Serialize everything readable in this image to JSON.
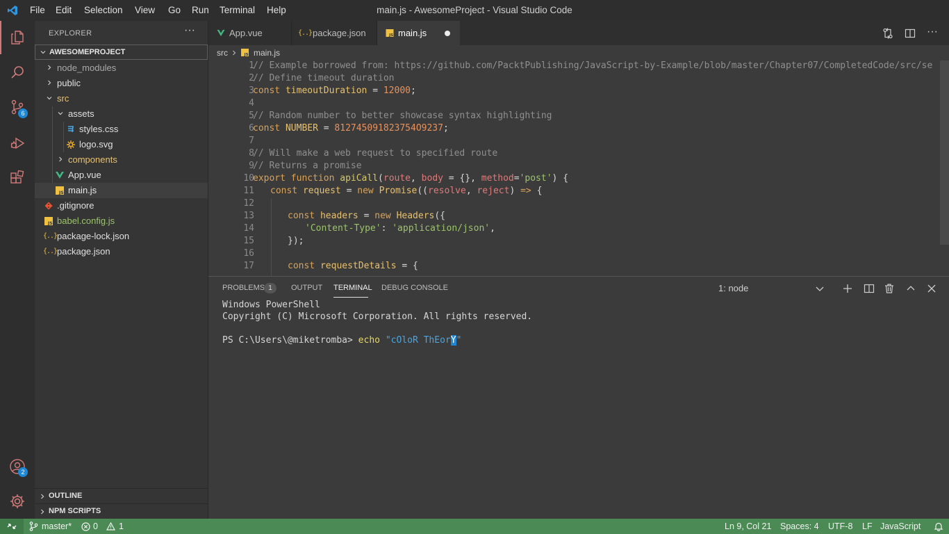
{
  "window": {
    "title": "main.js - AwesomeProject - Visual Studio Code",
    "menu": [
      "File",
      "Edit",
      "Selection",
      "View",
      "Go",
      "Run",
      "Terminal",
      "Help"
    ]
  },
  "activity_bar": {
    "items": [
      "explorer-icon",
      "search-icon",
      "source-control-icon",
      "run-debug-icon",
      "extensions-icon"
    ],
    "source_control_badge": "6",
    "accounts_badge": "2"
  },
  "sidebar": {
    "title": "EXPLORER",
    "more": "···",
    "project": "AWESOMEPROJECT",
    "tree": [
      {
        "label": "node_modules",
        "type": "folder"
      },
      {
        "label": "public",
        "type": "folder"
      },
      {
        "label": "src",
        "type": "folder-open"
      },
      {
        "label": "assets",
        "type": "folder-open"
      },
      {
        "label": "styles.css",
        "type": "css"
      },
      {
        "label": "logo.svg",
        "type": "svg"
      },
      {
        "label": "components",
        "type": "folder"
      },
      {
        "label": "App.vue",
        "type": "vue"
      },
      {
        "label": "main.js",
        "type": "js"
      },
      {
        "label": ".gitignore",
        "type": "git"
      },
      {
        "label": "babel.config.js",
        "type": "js"
      },
      {
        "label": "package-lock.json",
        "type": "json"
      },
      {
        "label": "package.json",
        "type": "json"
      }
    ],
    "sections": [
      "OUTLINE",
      "NPM SCRIPTS"
    ]
  },
  "editor": {
    "tabs": [
      {
        "label": "App.vue",
        "icon": "vue-icon"
      },
      {
        "label": "package.json",
        "icon": "json-icon"
      },
      {
        "label": "main.js",
        "icon": "js-icon",
        "active": true
      }
    ],
    "breadcrumb": [
      "src",
      "main.js"
    ],
    "line_numbers": [
      "1",
      "2",
      "3",
      "4",
      "5",
      "6",
      "7",
      "8",
      "9",
      "10",
      "11",
      "12",
      "13",
      "14",
      "15",
      "16",
      "17"
    ],
    "code": {
      "l1": "// Example borrowed from: https://github.com/PacktPublishing/JavaScript-by-Example/blob/master/Chapter07/CompletedCode/src/se",
      "l2": "// Define timeout duration",
      "l3_kw": "const",
      "l3_var": "timeoutDuration",
      "l3_eq": " = ",
      "l3_num": "12000",
      "l3_end": ";",
      "l5": "// Random number to better showcase syntax highlighting",
      "l6_kw": "const",
      "l6_var": "NUMBER",
      "l6_eq": " = ",
      "l6_num": "812745091823754O9237",
      "l6_end": ";",
      "l8": "// Will make a web request to specified route",
      "l9": "// Returns a promise",
      "l10_kw1": "export",
      "l10_kw2": "function",
      "l10_fn": "apiCall",
      "l10_p1": "(",
      "l10_a1": "route",
      "l10_p2": ", ",
      "l10_a2": "body",
      "l10_p3": " = {}, ",
      "l10_a3": "method",
      "l10_p4": "=",
      "l10_s": "'post'",
      "l10_p5": ") {",
      "l11_kw": "const",
      "l11_var": "request",
      "l11_eq": " = ",
      "l11_new": "new",
      "l11_cls": "Promise",
      "l11_p1": "((",
      "l11_a1": "resolve",
      "l11_p2": ", ",
      "l11_a2": "reject",
      "l11_p3": ") ",
      "l11_arrow": "=>",
      "l11_p4": " {",
      "l13_kw": "const",
      "l13_var": "headers",
      "l13_eq": " = ",
      "l13_new": "new",
      "l13_cls": "Headers",
      "l13_p": "({",
      "l14_s1": "'Content-Type'",
      "l14_p": ": ",
      "l14_s2": "'application/json'",
      "l14_end": ",",
      "l15": "});",
      "l17_kw": "const",
      "l17_var": "requestDetails",
      "l17_p": " = {"
    }
  },
  "panel": {
    "tabs": [
      "PROBLEMS",
      "OUTPUT",
      "TERMINAL",
      "DEBUG CONSOLE"
    ],
    "problems_count": "1",
    "terminal_select": "1: node",
    "terminal_lines": [
      "Windows PowerShell",
      "Copyright (C) Microsoft Corporation. All rights reserved."
    ],
    "prompt": "PS C:\\Users\\@miketromba> ",
    "command": "echo",
    "arg_text": "\"cOloR ThEor",
    "arg_cursor": "Y",
    "arg_end": "\""
  },
  "status_bar": {
    "branch": "master*",
    "errors": "0",
    "warnings": "1",
    "position": "Ln 9, Col 21",
    "spaces": "Spaces: 4",
    "encoding": "UTF-8",
    "eol": "LF",
    "language": "JavaScript"
  },
  "colors": {
    "accent_blue": "#1e88d6",
    "status_green": "#4b8a55",
    "vue_green": "#41b883",
    "js_yellow": "#f0c040"
  }
}
